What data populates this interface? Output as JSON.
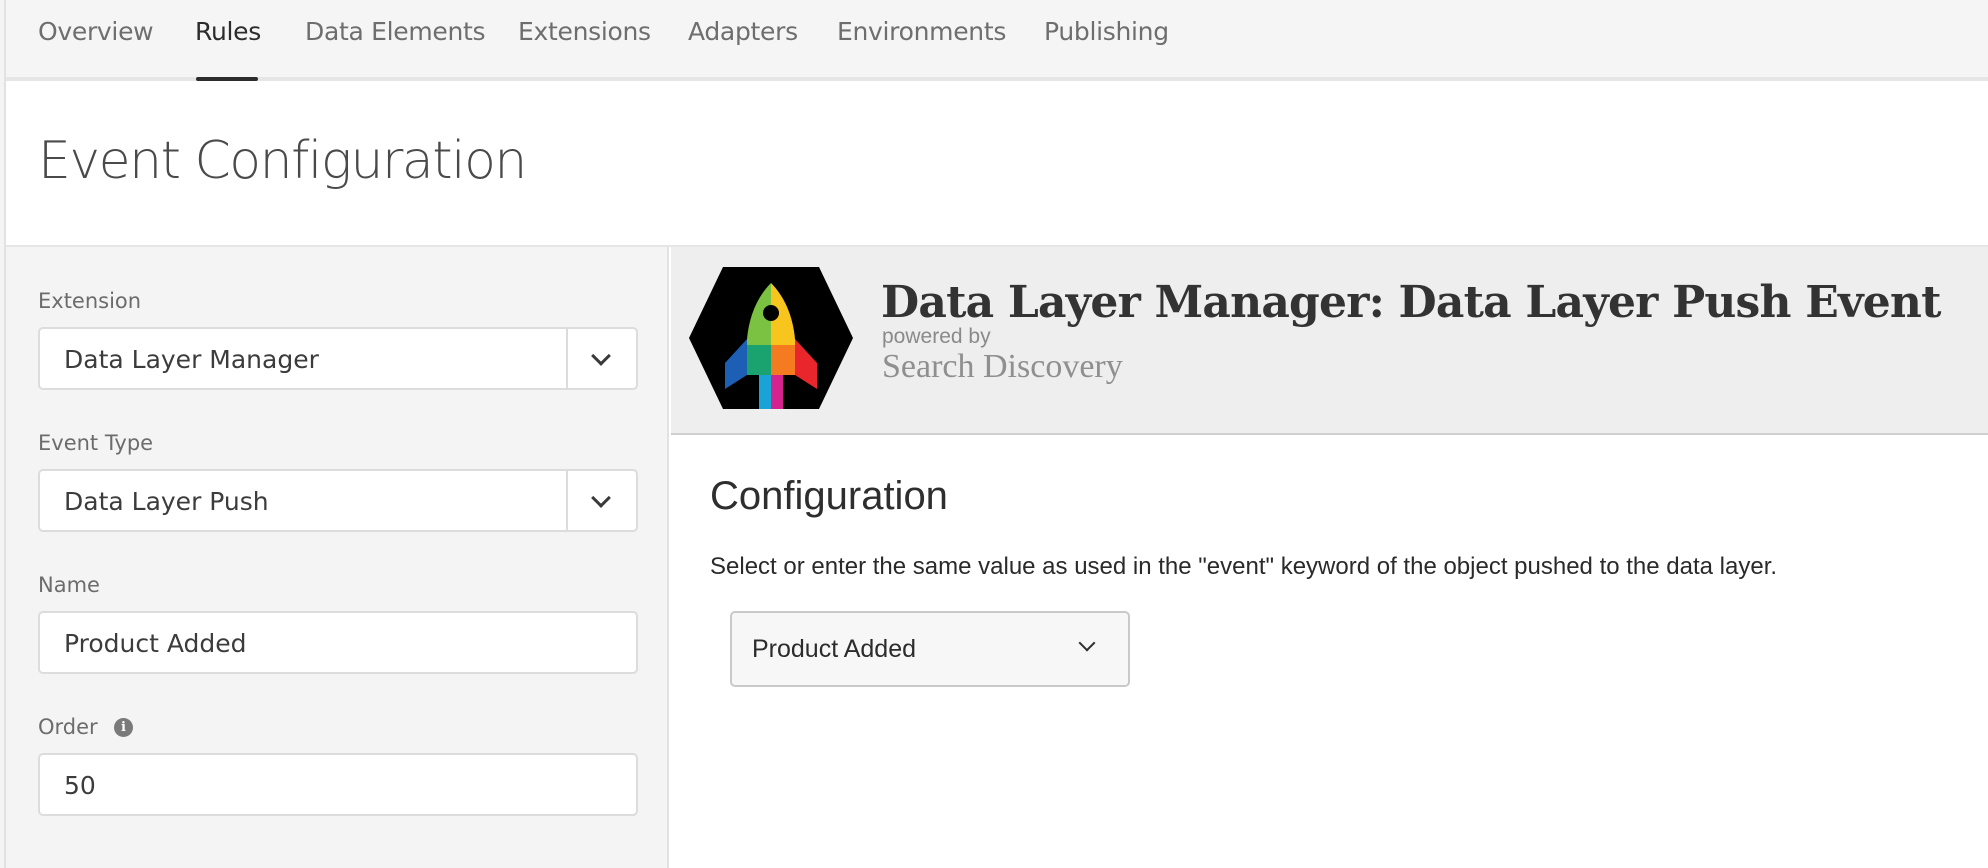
{
  "nav": {
    "tabs": [
      {
        "label": "Overview"
      },
      {
        "label": "Rules"
      },
      {
        "label": "Data Elements"
      },
      {
        "label": "Extensions"
      },
      {
        "label": "Adapters"
      },
      {
        "label": "Environments"
      },
      {
        "label": "Publishing"
      }
    ],
    "active_tab": "Rules"
  },
  "page": {
    "title": "Event Configuration"
  },
  "form": {
    "extension": {
      "label": "Extension",
      "value": "Data Layer Manager"
    },
    "event_type": {
      "label": "Event Type",
      "value": "Data Layer Push"
    },
    "name": {
      "label": "Name",
      "value": "Product Added"
    },
    "order": {
      "label": "Order",
      "value": "50",
      "info_icon": "info-icon"
    }
  },
  "extension_header": {
    "title": "Data Layer Manager: Data Layer Push Event",
    "powered_by": "powered by",
    "vendor": "Search Discovery",
    "logo_icon": "rocket-logo"
  },
  "configuration": {
    "title": "Configuration",
    "description": "Select or enter the same value as used in the \"event\" keyword of the object pushed to the data layer.",
    "event_select": {
      "value": "Product Added"
    }
  },
  "colors": {
    "nav_background": "#f5f5f5",
    "panel_background": "#f4f4f4",
    "header_background": "#eeeeee",
    "active_underline": "#2c2c2c"
  }
}
